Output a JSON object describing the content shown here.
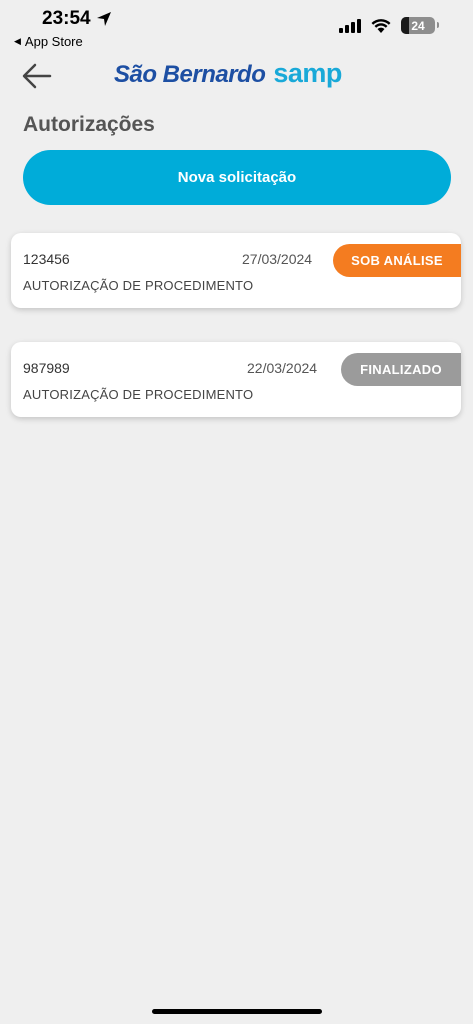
{
  "status_bar": {
    "time": "23:54",
    "back_label": "App Store",
    "battery": "24",
    "battery_level": 0.24
  },
  "header": {
    "logo_part1": "São Bernardo",
    "logo_part2": "samp"
  },
  "page": {
    "title": "Autorizações",
    "new_button_label": "Nova solicitação"
  },
  "authorizations": [
    {
      "number": "123456",
      "date": "27/03/2024",
      "type": "AUTORIZAÇÃO DE PROCEDIMENTO",
      "status": "SOB ANÁLISE",
      "status_color": "#f47c20"
    },
    {
      "number": "987989",
      "date": "22/03/2024",
      "type": "AUTORIZAÇÃO DE PROCEDIMENTO",
      "status": "FINALIZADO",
      "status_color": "#9b9b9b"
    }
  ],
  "colors": {
    "accent": "#00acd9",
    "brand_blue": "#1d4fa3",
    "brand_red": "#e31d2b",
    "background": "#efefef"
  }
}
